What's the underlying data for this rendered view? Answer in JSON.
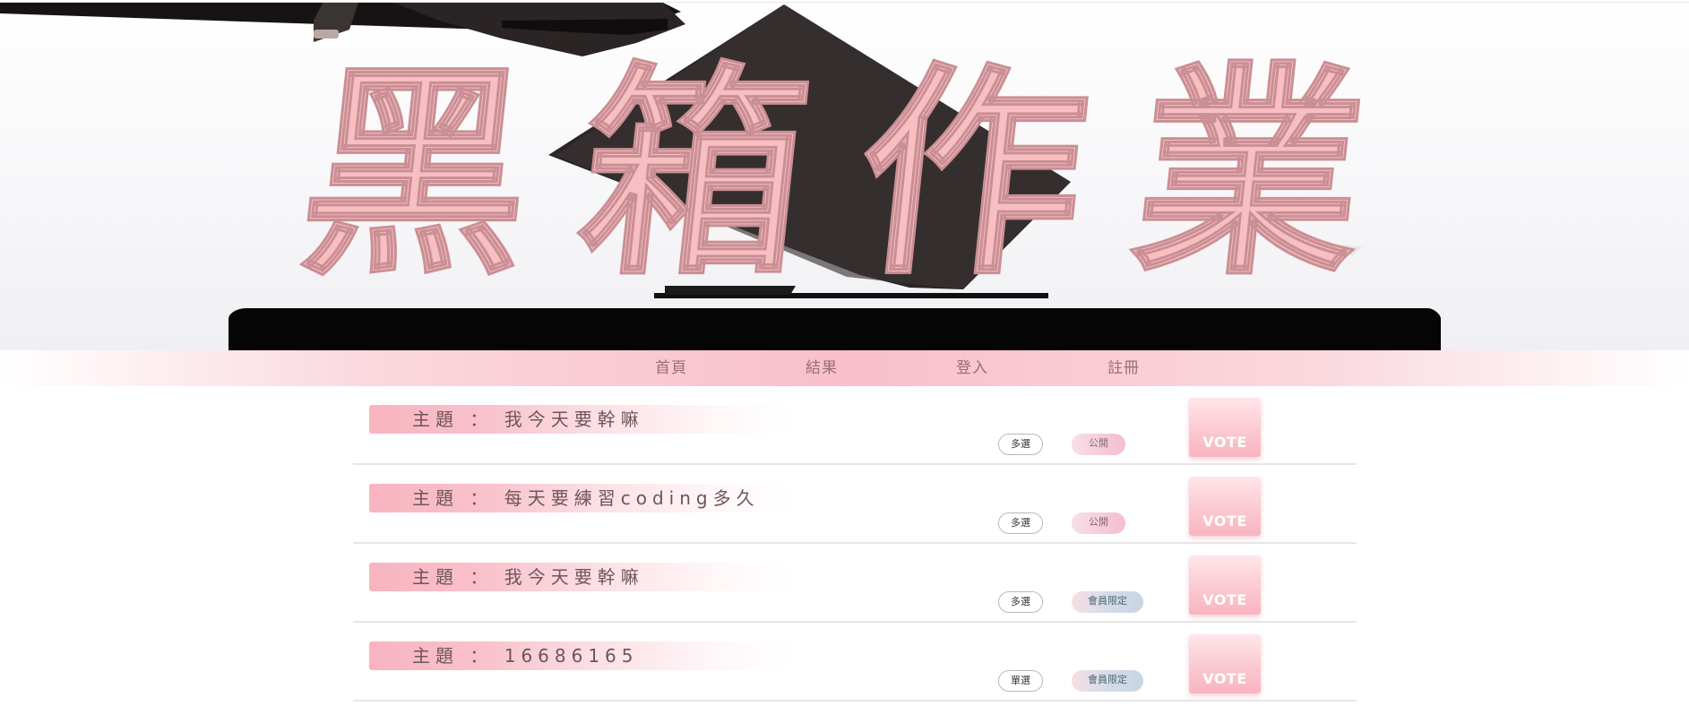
{
  "banner": {
    "title_chars": [
      "黑",
      "箱",
      "作",
      "業"
    ]
  },
  "nav": {
    "items": [
      "首頁",
      "結果",
      "登入",
      "註冊"
    ]
  },
  "polls": [
    {
      "topic": "主題 ： 我今天要幹嘛",
      "type": "多選",
      "visibility": "公開",
      "vote_label": "VOTE"
    },
    {
      "topic": "主題 ： 每天要練習coding多久",
      "type": "多選",
      "visibility": "公開",
      "vote_label": "VOTE"
    },
    {
      "topic": "主題 ： 我今天要幹嘛",
      "type": "多選",
      "visibility": "會員限定",
      "vote_label": "VOTE"
    },
    {
      "topic": "主題 ： 16686165",
      "type": "單選",
      "visibility": "會員限定",
      "vote_label": "VOTE"
    }
  ],
  "colors": {
    "accent_pink": "#f8b4c0",
    "title_pink": "#f8bfc2",
    "nav_text": "#9b6f73"
  }
}
